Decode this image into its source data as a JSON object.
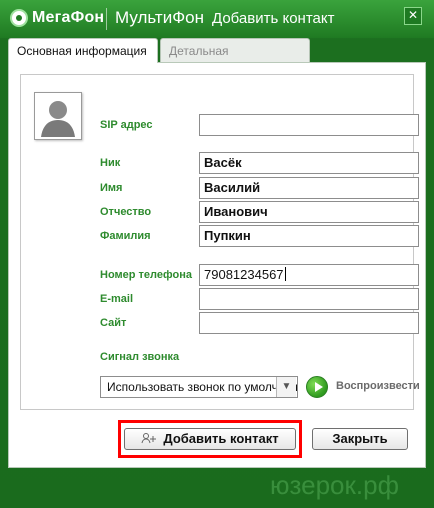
{
  "window": {
    "brand": "МегаФон",
    "product": "МультиФон",
    "title": "Добавить контакт",
    "close_symbol": "✕"
  },
  "tabs": [
    {
      "label": "Основная информация",
      "active": true
    },
    {
      "label": "Детальная информация",
      "active": false
    }
  ],
  "form": {
    "sip": {
      "label": "SIP адрес",
      "value": ""
    },
    "nick": {
      "label": "Ник",
      "value": "Васёк"
    },
    "first_name": {
      "label": "Имя",
      "value": "Василий"
    },
    "patronymic": {
      "label": "Отчество",
      "value": "Иванович"
    },
    "last_name": {
      "label": "Фамилия",
      "value": "Пупкин"
    },
    "phone": {
      "label": "Номер телефона",
      "value": "79081234567"
    },
    "email": {
      "label": "E-mail",
      "value": ""
    },
    "site": {
      "label": "Сайт",
      "value": ""
    },
    "ringtone": {
      "label": "Сигнал звонка",
      "selected": "Использовать звонок по умолчанию",
      "play_label": "Воспроизвести"
    }
  },
  "buttons": {
    "add": "Добавить контакт",
    "close": "Закрыть"
  },
  "watermark": "юзерок.рф",
  "colors": {
    "brand_green": "#1f7a22",
    "label_green": "#2e8b2e",
    "highlight_red": "#ff0000"
  }
}
